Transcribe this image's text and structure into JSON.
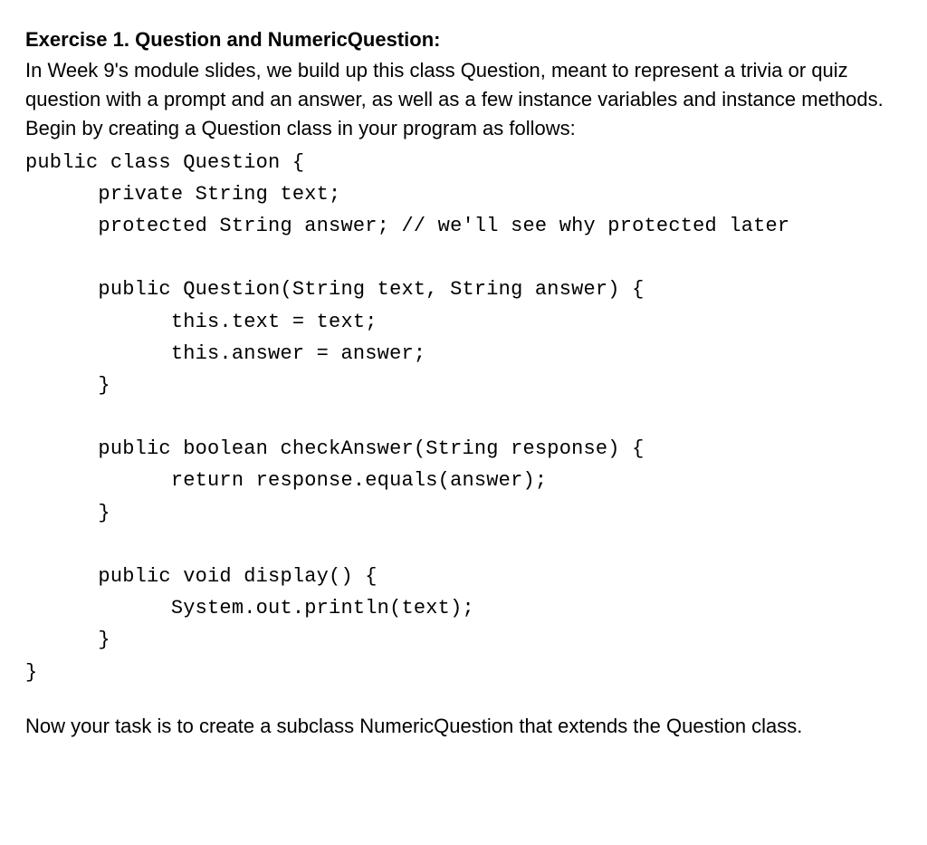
{
  "heading": "Exercise 1. Question and NumericQuestion:",
  "intro": "In Week 9's module slides, we build up this class Question, meant to represent a trivia or quiz question with a prompt and an answer, as well as a few instance variables and instance methods. Begin by creating a Question class in your program as follows:",
  "code": "public class Question {\n      private String text;\n      protected String answer; // we'll see why protected later\n\n      public Question(String text, String answer) {\n            this.text = text;\n            this.answer = answer;\n      }\n\n      public boolean checkAnswer(String response) {\n            return response.equals(answer);\n      }\n\n      public void display() {\n            System.out.println(text);\n      }\n}",
  "outro": "Now your task is to create a subclass NumericQuestion that extends the Question class."
}
